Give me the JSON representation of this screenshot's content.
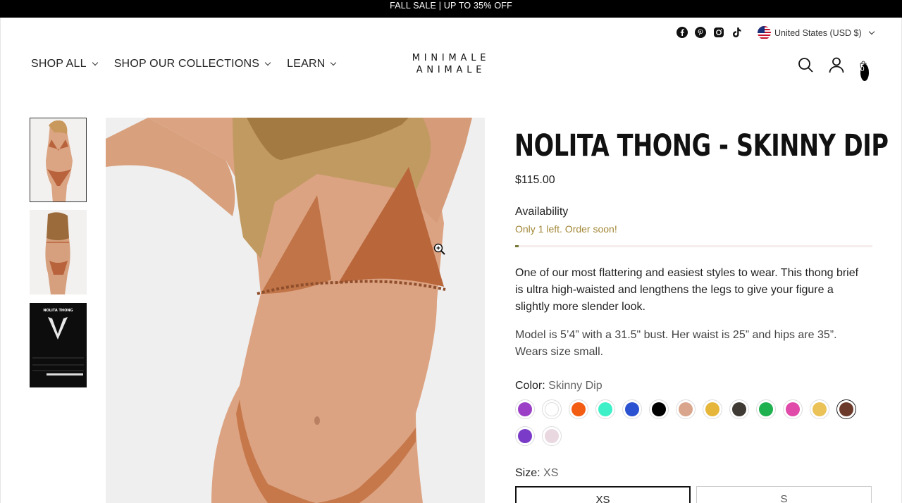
{
  "announcement": "FALL SALE | UP TO 35% OFF",
  "social": [
    "facebook-icon",
    "pinterest-icon",
    "instagram-icon",
    "tiktok-icon"
  ],
  "currency": {
    "label": "United States (USD $)"
  },
  "nav": [
    {
      "label": "SHOP ALL"
    },
    {
      "label": "SHOP OUR COLLECTIONS"
    },
    {
      "label": "LEARN"
    }
  ],
  "logo": {
    "line1": "MINIMALE",
    "line2": "ANIMALE"
  },
  "cart": {
    "count": "0"
  },
  "thumbnails": {
    "t3_title": "NOLITA THONG"
  },
  "product": {
    "title": "NOLITA THONG - SKINNY DIP",
    "price": "$115.00",
    "availability_label": "Availability",
    "availability_msg": "Only 1 left. Order soon!",
    "stock_fraction": 0.01,
    "description": "One of our most flattering and easiest styles to wear. This thong brief is ultra high-waisted and lengthens the legs to give your figure a slightly more slender look.",
    "model_info": "Model is 5’4” with a 31.5\" bust. Her waist is 25” and hips are 35”. Wears size small.",
    "color_label": "Color:",
    "color_value": "Skinny Dip",
    "size_label": "Size:",
    "size_value": "XS",
    "sizes": [
      "XS",
      "S"
    ]
  },
  "colors": {
    "swatches": [
      "#9b3fc7",
      "#ffffff",
      "#f25c13",
      "#3ef0c8",
      "#2b52d1",
      "#000000",
      "#d9a58c",
      "#e6b63a",
      "#3f3a33",
      "#1fb050",
      "#e04aa9",
      "#eac257",
      "#6b3a2a",
      "#7a3cc8",
      "#e9d8e0"
    ],
    "selected_index": 12
  }
}
